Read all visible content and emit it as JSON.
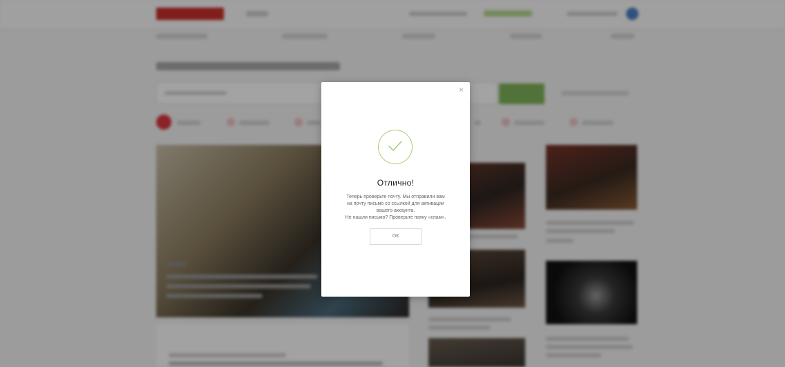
{
  "modal": {
    "close_glyph": "×",
    "title": "Отлично!",
    "message_lines": [
      "Теперь проверьте почту. Мы отправили вам",
      "на почту письмо со ссылкой для активации",
      "вашего аккаунта.",
      "Не нашли письмо? Проверьте папку «спам»."
    ],
    "ok_label": "ОК",
    "icon": "checkmark-circle-icon"
  },
  "colors": {
    "overlay": "rgba(0,0,0,0.36)",
    "check_accent": "#a8cc72",
    "brand_red": "#c9302c",
    "search_button_green": "#7fb55a"
  }
}
